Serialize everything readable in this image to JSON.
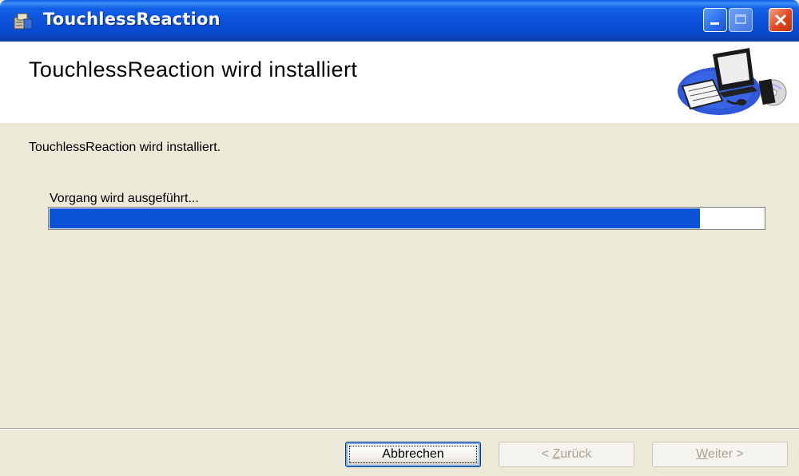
{
  "window": {
    "title": "TouchlessReaction",
    "icon": "installer-package-icon"
  },
  "banner": {
    "title": "TouchlessReaction wird installiert",
    "art": "computer-cd-illustration"
  },
  "content": {
    "status": "TouchlessReaction wird installiert.",
    "action": "Vorgang wird ausgeführt...",
    "progress_fraction": 0.91
  },
  "buttons": {
    "cancel": "Abbrechen",
    "back_prefix": "< ",
    "back_key": "Z",
    "back_rest": "urück",
    "next_key": "W",
    "next_rest": "eiter >"
  },
  "colors": {
    "progress_fill": "#0a52d6",
    "titlebar": "#0a4fd6",
    "window_bg": "#ece9d8"
  }
}
